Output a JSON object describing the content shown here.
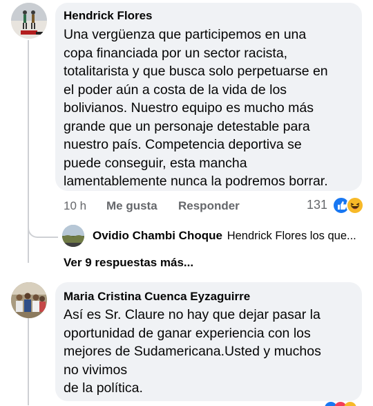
{
  "comments": [
    {
      "author": "Hendrick Flores",
      "avatar_icon": "profile-photo-runners",
      "text_lines": [
        "Una vergüenza que participemos en una",
        "copa financiada por un sector racista,",
        "totalitarista y que busca solo perpetuarse en",
        "el poder aún a costa de la vida de los",
        "bolivianos. Nuestro equipo es mucho más",
        "grande que un personaje detestable para",
        "nuestro país. Competencia deportiva se",
        "puede conseguir, esta mancha",
        "lamentablemente nunca la podremos borrar."
      ],
      "time": "10 h",
      "like_label": "Me gusta",
      "reply_label": "Responder",
      "reaction_count": "131",
      "reactions": [
        "like-reaction",
        "haha-reaction"
      ],
      "reply_preview": {
        "author": "Ovidio Chambi Choque",
        "snippet": "Hendrick Flores los que...",
        "avatar_icon": "profile-photo-landscape"
      },
      "more_replies_label": "Ver 9 respuestas más..."
    },
    {
      "author": "Maria Cristina Cuenca Eyzaguirre",
      "avatar_icon": "profile-photo-group",
      "text_lines": [
        "Así es Sr. Claure no hay que dejar pasar la",
        "oportunidad de ganar experiencia con los",
        "mejores de Sudamericana.Usted y muchos",
        "no vivimos",
        "de la política."
      ]
    }
  ],
  "colors": {
    "bubble": "#f0f2f5",
    "text": "#050505",
    "secondary": "#65676b",
    "thread_line": "#ced0d4",
    "like_blue": "#1877f2",
    "haha_yellow": "#f7b928"
  }
}
